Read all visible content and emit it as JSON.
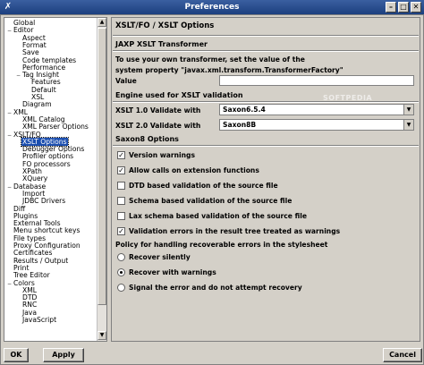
{
  "window": {
    "title": "Preferences",
    "app_icon": "x-icon",
    "minimize": "–",
    "maximize": "□",
    "close": "✕"
  },
  "tree": {
    "items": [
      {
        "label": "Global",
        "level": 0,
        "expander": "",
        "selected": false
      },
      {
        "label": "Editor",
        "level": 0,
        "expander": "−",
        "selected": false
      },
      {
        "label": "Aspect",
        "level": 1,
        "expander": "",
        "selected": false
      },
      {
        "label": "Format",
        "level": 1,
        "expander": "",
        "selected": false
      },
      {
        "label": "Save",
        "level": 1,
        "expander": "",
        "selected": false
      },
      {
        "label": "Code templates",
        "level": 1,
        "expander": "",
        "selected": false
      },
      {
        "label": "Performance",
        "level": 1,
        "expander": "",
        "selected": false
      },
      {
        "label": "Tag Insight",
        "level": 1,
        "expander": "−",
        "selected": false
      },
      {
        "label": "Features",
        "level": 2,
        "expander": "",
        "selected": false
      },
      {
        "label": "Default",
        "level": 2,
        "expander": "",
        "selected": false
      },
      {
        "label": "XSL",
        "level": 2,
        "expander": "",
        "selected": false
      },
      {
        "label": "Diagram",
        "level": 1,
        "expander": "",
        "selected": false
      },
      {
        "label": "XML",
        "level": 0,
        "expander": "−",
        "selected": false
      },
      {
        "label": "XML Catalog",
        "level": 1,
        "expander": "",
        "selected": false
      },
      {
        "label": "XML Parser Options",
        "level": 1,
        "expander": "",
        "selected": false
      },
      {
        "label": "XSLT/FO",
        "level": 0,
        "expander": "−",
        "selected": false
      },
      {
        "label": "XSLT Options",
        "level": 1,
        "expander": "",
        "selected": true
      },
      {
        "label": "Debugger Options",
        "level": 1,
        "expander": "",
        "selected": false
      },
      {
        "label": "Profiler options",
        "level": 1,
        "expander": "",
        "selected": false
      },
      {
        "label": "FO processors",
        "level": 1,
        "expander": "",
        "selected": false
      },
      {
        "label": "XPath",
        "level": 1,
        "expander": "",
        "selected": false
      },
      {
        "label": "XQuery",
        "level": 1,
        "expander": "",
        "selected": false
      },
      {
        "label": "Database",
        "level": 0,
        "expander": "−",
        "selected": false
      },
      {
        "label": "Import",
        "level": 1,
        "expander": "",
        "selected": false
      },
      {
        "label": "JDBC Drivers",
        "level": 1,
        "expander": "",
        "selected": false
      },
      {
        "label": "Diff",
        "level": 0,
        "expander": "",
        "selected": false
      },
      {
        "label": "Plugins",
        "level": 0,
        "expander": "",
        "selected": false
      },
      {
        "label": "External Tools",
        "level": 0,
        "expander": "",
        "selected": false
      },
      {
        "label": "Menu shortcut keys",
        "level": 0,
        "expander": "",
        "selected": false
      },
      {
        "label": "File types",
        "level": 0,
        "expander": "",
        "selected": false
      },
      {
        "label": "Proxy Configuration",
        "level": 0,
        "expander": "",
        "selected": false
      },
      {
        "label": "Certificates",
        "level": 0,
        "expander": "",
        "selected": false
      },
      {
        "label": "Results / Output",
        "level": 0,
        "expander": "",
        "selected": false
      },
      {
        "label": "Print",
        "level": 0,
        "expander": "",
        "selected": false
      },
      {
        "label": "Tree Editor",
        "level": 0,
        "expander": "",
        "selected": false
      },
      {
        "label": "Colors",
        "level": 0,
        "expander": "−",
        "selected": false
      },
      {
        "label": "XML",
        "level": 1,
        "expander": "",
        "selected": false
      },
      {
        "label": "DTD",
        "level": 1,
        "expander": "",
        "selected": false
      },
      {
        "label": "RNC",
        "level": 1,
        "expander": "",
        "selected": false
      },
      {
        "label": "Java",
        "level": 1,
        "expander": "",
        "selected": false
      },
      {
        "label": "JavaScript",
        "level": 1,
        "expander": "",
        "selected": false
      }
    ]
  },
  "panel": {
    "title": "XSLT/FO / XSLT Options",
    "jaxp_section": "JAXP XSLT Transformer",
    "jaxp_desc_line1": "To use your own transformer, set the value of the",
    "jaxp_desc_line2": "system property \"javax.xml.transform.TransformerFactory\"",
    "value_label": "Value",
    "value_input": "",
    "engine_label": "Engine used for XSLT validation",
    "xslt1_label": "XSLT 1.0 Validate with",
    "xslt1_value": "Saxon6.5.4",
    "xslt2_label": "XSLT 2.0 Validate with",
    "xslt2_value": "Saxon8B",
    "saxon_section": "Saxon8 Options",
    "checkboxes": [
      {
        "label": "Version warnings",
        "checked": true
      },
      {
        "label": "Allow calls on extension functions",
        "checked": true
      },
      {
        "label": "DTD based validation of the source file",
        "checked": false
      },
      {
        "label": "Schema based validation of the source file",
        "checked": false
      },
      {
        "label": "Lax schema based validation of the source file",
        "checked": false
      },
      {
        "label": "Validation errors in the result tree treated as warnings",
        "checked": true
      }
    ],
    "policy_label": "Policy for handling recoverable errors in the stylesheet",
    "radios": [
      {
        "label": "Recover silently",
        "selected": false
      },
      {
        "label": "Recover with warnings",
        "selected": true
      },
      {
        "label": "Signal the error and do not attempt recovery",
        "selected": false
      }
    ],
    "watermark": "SOFTPEDIA"
  },
  "buttons": {
    "ok": "OK",
    "apply": "Apply",
    "cancel": "Cancel"
  },
  "colors": {
    "title_bar": "#1c3f7f",
    "selection": "#1c4fb0",
    "background": "#d4d0c8"
  }
}
